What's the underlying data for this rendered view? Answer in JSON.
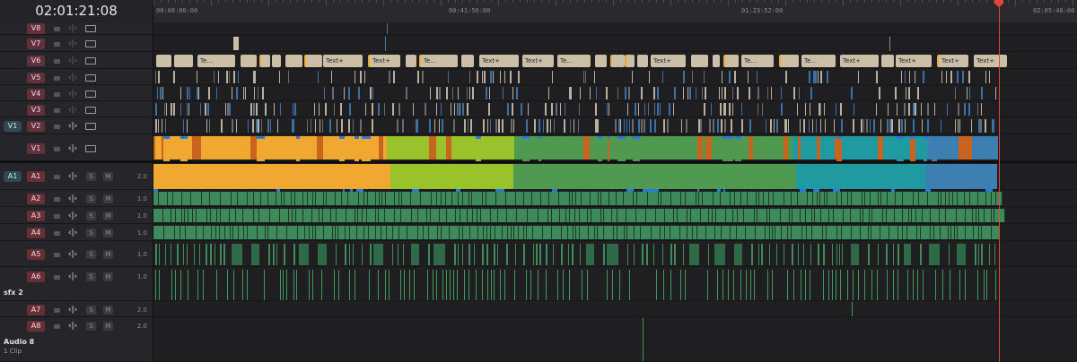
{
  "timecode": "02:01:21:08",
  "ruler": {
    "labels": [
      "00:00:00:00",
      "00:41:56:00",
      "01:23:52:00",
      "02:05:48:00"
    ]
  },
  "icons": {
    "lock": "lock-icon",
    "link": "link-icon",
    "monitor": "monitor-icon"
  },
  "glyphs": {
    "link": "‹|›"
  },
  "buttons": {
    "solo": "S",
    "mute": "M"
  },
  "source_tags": {
    "video": "V1",
    "audio": "A1"
  },
  "video_tracks": [
    "V8",
    "V7",
    "V6",
    "V5",
    "V4",
    "V3",
    "V2",
    "V1"
  ],
  "audio_tracks": [
    {
      "label": "A1",
      "volume": "2.0"
    },
    {
      "label": "A2",
      "volume": "1.0"
    },
    {
      "label": "A3",
      "volume": "1.0"
    },
    {
      "label": "A4",
      "volume": "1.0"
    },
    {
      "label": "A5",
      "volume": "1.0"
    },
    {
      "label": "A6",
      "volume": "1.0"
    },
    {
      "label": "A7",
      "volume": "2.0"
    },
    {
      "label": "A8",
      "volume": "2.0"
    }
  ],
  "track_names": {
    "a6_name": "sfx 2",
    "a8_name": "Audio 8",
    "a8_sub": "1 Clip"
  },
  "text_clips": [
    "Te...",
    "Text+",
    "Text+",
    "Te...",
    "Text+",
    "Text+",
    "Te...",
    "Text+",
    "Te...",
    "Te...",
    "Text+",
    "Text+",
    "Text+",
    "Text+",
    "Te..."
  ],
  "colors": {
    "orange": "#f0a830",
    "lime": "#9ac22a",
    "green": "#4f9a50",
    "teal": "#1f9aa0",
    "blue": "#2c7ad8",
    "audio_green": "#3f8a5a",
    "playhead": "#e0453a",
    "text_clip": "#cbbfa8"
  }
}
